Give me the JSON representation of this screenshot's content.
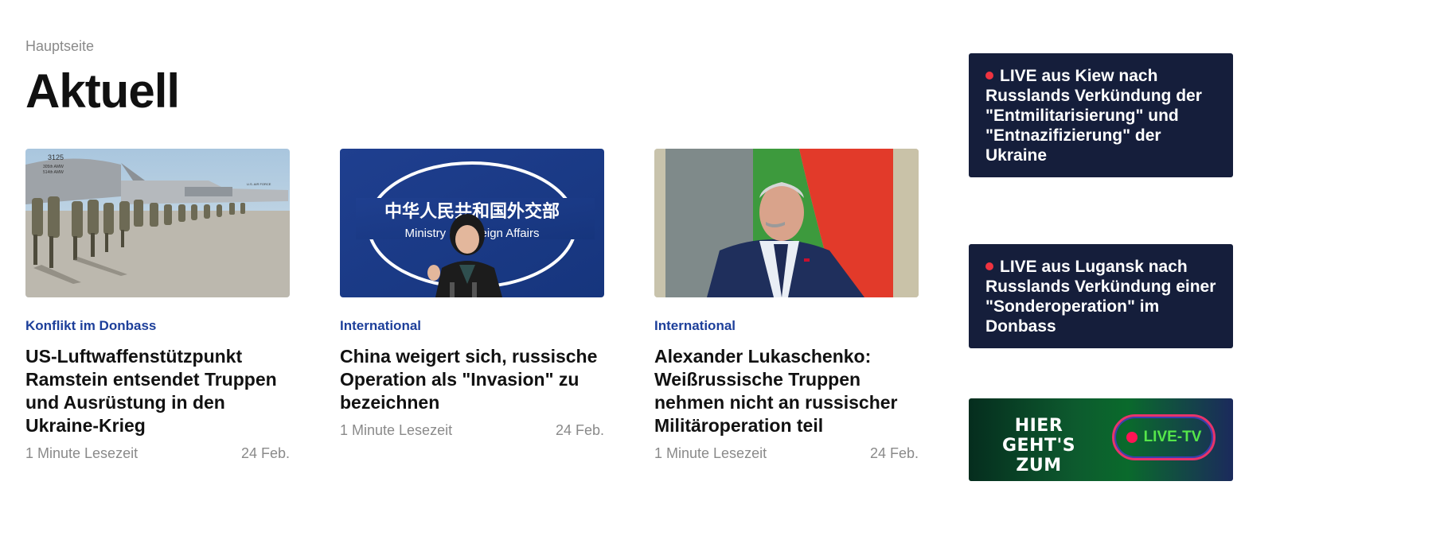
{
  "breadcrumb": "Hauptseite",
  "page_title": "Aktuell",
  "articles": [
    {
      "category": "Konflikt im Donbass",
      "headline": "US-Luftwaffenstützpunkt Ramstein entsendet Truppen und Ausrüstung in den Ukraine-Krieg",
      "reading_time": "1 Minute Lesezeit",
      "date": "24 Feb.",
      "image_text": [
        "3125",
        "305th AMW",
        "514th AMW",
        "U.S. AIR FORCE"
      ]
    },
    {
      "category": "International",
      "headline": "China weigert sich, russische Operation als \"Invasion\" zu bezeichnen",
      "reading_time": "1 Minute Lesezeit",
      "date": "24 Feb.",
      "image_text": [
        "中华人民共和国外交部",
        "Ministry of Foreign Affairs"
      ]
    },
    {
      "category": "International",
      "headline": "Alexander Lukaschenko: Weißrussische Truppen nehmen nicht an russischer Militäroperation teil",
      "reading_time": "1 Minute Lesezeit",
      "date": "24 Feb."
    }
  ],
  "sidebar": {
    "live_1": "LIVE aus Kiew nach Russlands Verkündung der \"Entmilitarisierung\" und \"Entnazifizierung\" der Ukraine",
    "live_2": "LIVE aus Lugansk nach Russlands Verkündung einer \"Sonderoperation\" im Donbass",
    "tv_banner": {
      "line_1": "HIER",
      "line_2": "GEHT'S ZUM",
      "button_label": "LIVE-TV"
    }
  },
  "colors": {
    "category": "#1d3f9a",
    "sidebar_bg": "#151e3b",
    "live_dot": "#ef3340",
    "tv_label": "#55e64a"
  }
}
